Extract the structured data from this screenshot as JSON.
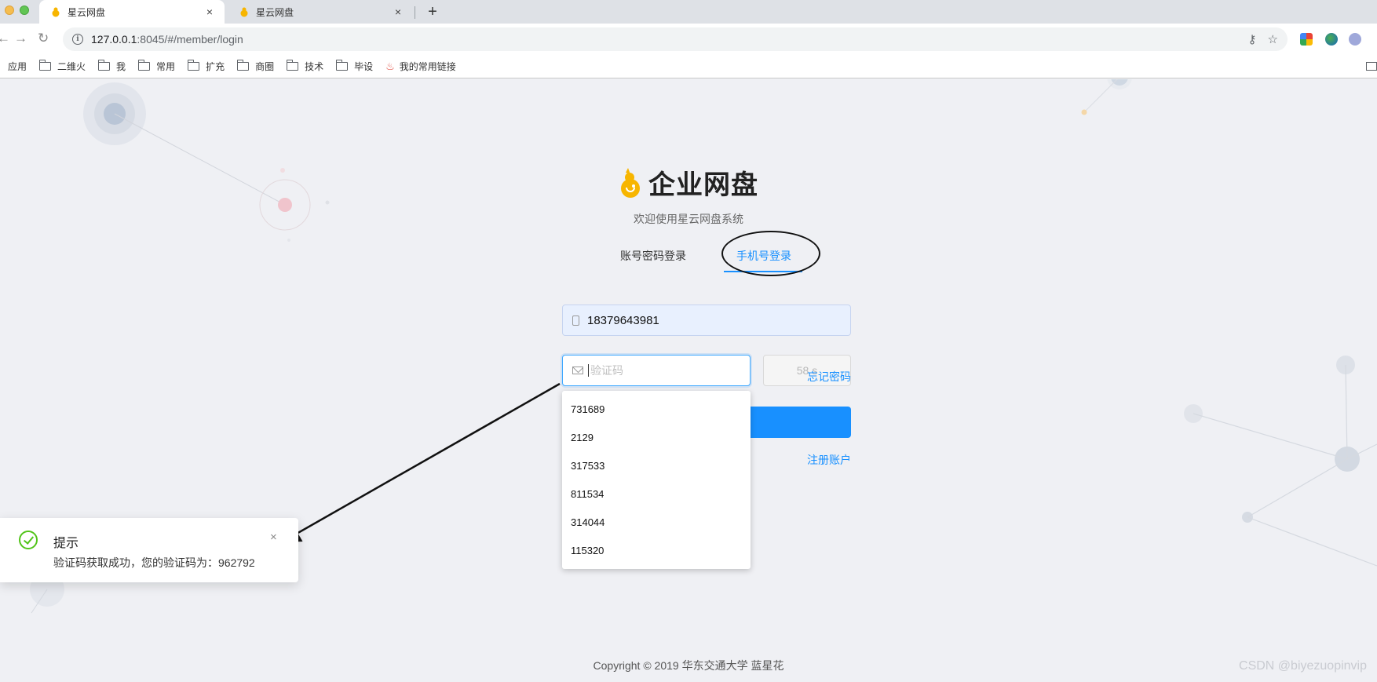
{
  "browser": {
    "tabs": [
      {
        "title": "星云网盘",
        "close": "×"
      },
      {
        "title": "星云网盘",
        "close": "×"
      }
    ],
    "new_tab": "+",
    "nav": {
      "back": "←",
      "forward": "→",
      "reload": "↻"
    },
    "url_host": "127.0.0.1",
    "url_rest": ":8045/#/member/login",
    "omnibox_icons": {
      "key": "⚷",
      "star": "☆"
    },
    "bookmarks": [
      "应用",
      "二维火",
      "我",
      "常用",
      "扩充",
      "商圈",
      "技术",
      "毕设",
      "我的常用链接"
    ]
  },
  "app": {
    "title": "企业网盘",
    "subtitle": "欢迎使用星云网盘系统",
    "tabs": {
      "account": "账号密码登录",
      "phone": "手机号登录"
    },
    "phone_value": "18379643981",
    "code_placeholder": "验证码",
    "countdown": "58 s",
    "forgot": "忘记密码",
    "register": "注册账户",
    "autocomplete": [
      "731689",
      "2129",
      "317533",
      "811534",
      "314044",
      "115320"
    ],
    "footer": "Copyright © 2019 华东交通大学 蓝星花"
  },
  "notification": {
    "title": "提示",
    "message": "验证码获取成功，您的验证码为：962792",
    "close": "×"
  },
  "watermark": "CSDN @biyezuopinvip",
  "colors": {
    "primary": "#1890ff",
    "success": "#52c41a",
    "background": "#eff0f4"
  }
}
